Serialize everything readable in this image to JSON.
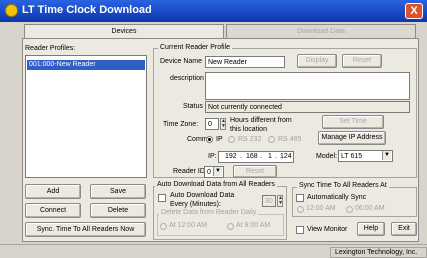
{
  "window": {
    "title": "LT Time Clock Download",
    "close_glyph": "X"
  },
  "tabs": [
    "Devices",
    "Download Data"
  ],
  "profiles": {
    "label": "Reader Profiles:",
    "items": [
      "001:000-New Reader"
    ]
  },
  "left_buttons": {
    "add": "Add",
    "save": "Save",
    "connect": "Connect",
    "delete": "Delete",
    "sync_all": "Sync. Time To All Readers Now"
  },
  "current_profile": {
    "group_label": "Current Reader Profile",
    "device_name_label": "Device Name",
    "device_name": "New Reader",
    "display_button": "Display",
    "reset_button": "Reset",
    "description_label": "description",
    "description": "",
    "status_label": "Status",
    "status": "Not currently connected",
    "timezone_label": "Time Zone:",
    "timezone_value": "0",
    "timezone_hint_1": "Hours different from",
    "timezone_hint_2": "this location",
    "set_time_button": "Set Time",
    "comm_label": "Comm:",
    "comm_options": [
      "IP",
      "RS 232",
      "RS 485"
    ],
    "manage_ip_button": "Manage IP Address",
    "ip_label": "IP:",
    "ip_parts": [
      "192",
      "168",
      "1",
      "124"
    ],
    "model_label": "Model:",
    "model_value": "LT 615",
    "reader_id_label": "Reader ID:",
    "reader_id_value": "0",
    "reset2_button": "Reset"
  },
  "auto_download": {
    "group_label": "Auto Download Data from All Readers",
    "checkbox_label_1": "Auto Download Data",
    "checkbox_label_2": "Every (Minutes):",
    "minutes": "30",
    "subgroup_label": "Delete Data from Reader Daily",
    "options": [
      "At 12:00 AM",
      "At 9:00 AM"
    ]
  },
  "sync_time": {
    "group_label": "Sync Time To All Readers At",
    "checkbox_label": "Automatically Sync",
    "options": [
      "12:00 AM",
      "06:00 AM"
    ]
  },
  "bottom": {
    "view_monitor": "View Monitor",
    "help": "Help",
    "exit": "Exit"
  },
  "statusbar": {
    "company": "Lexington Technology, Inc."
  },
  "colors": {
    "titlebar": "#1846c4",
    "selection": "#2f5fc4",
    "close": "#d9542c"
  }
}
